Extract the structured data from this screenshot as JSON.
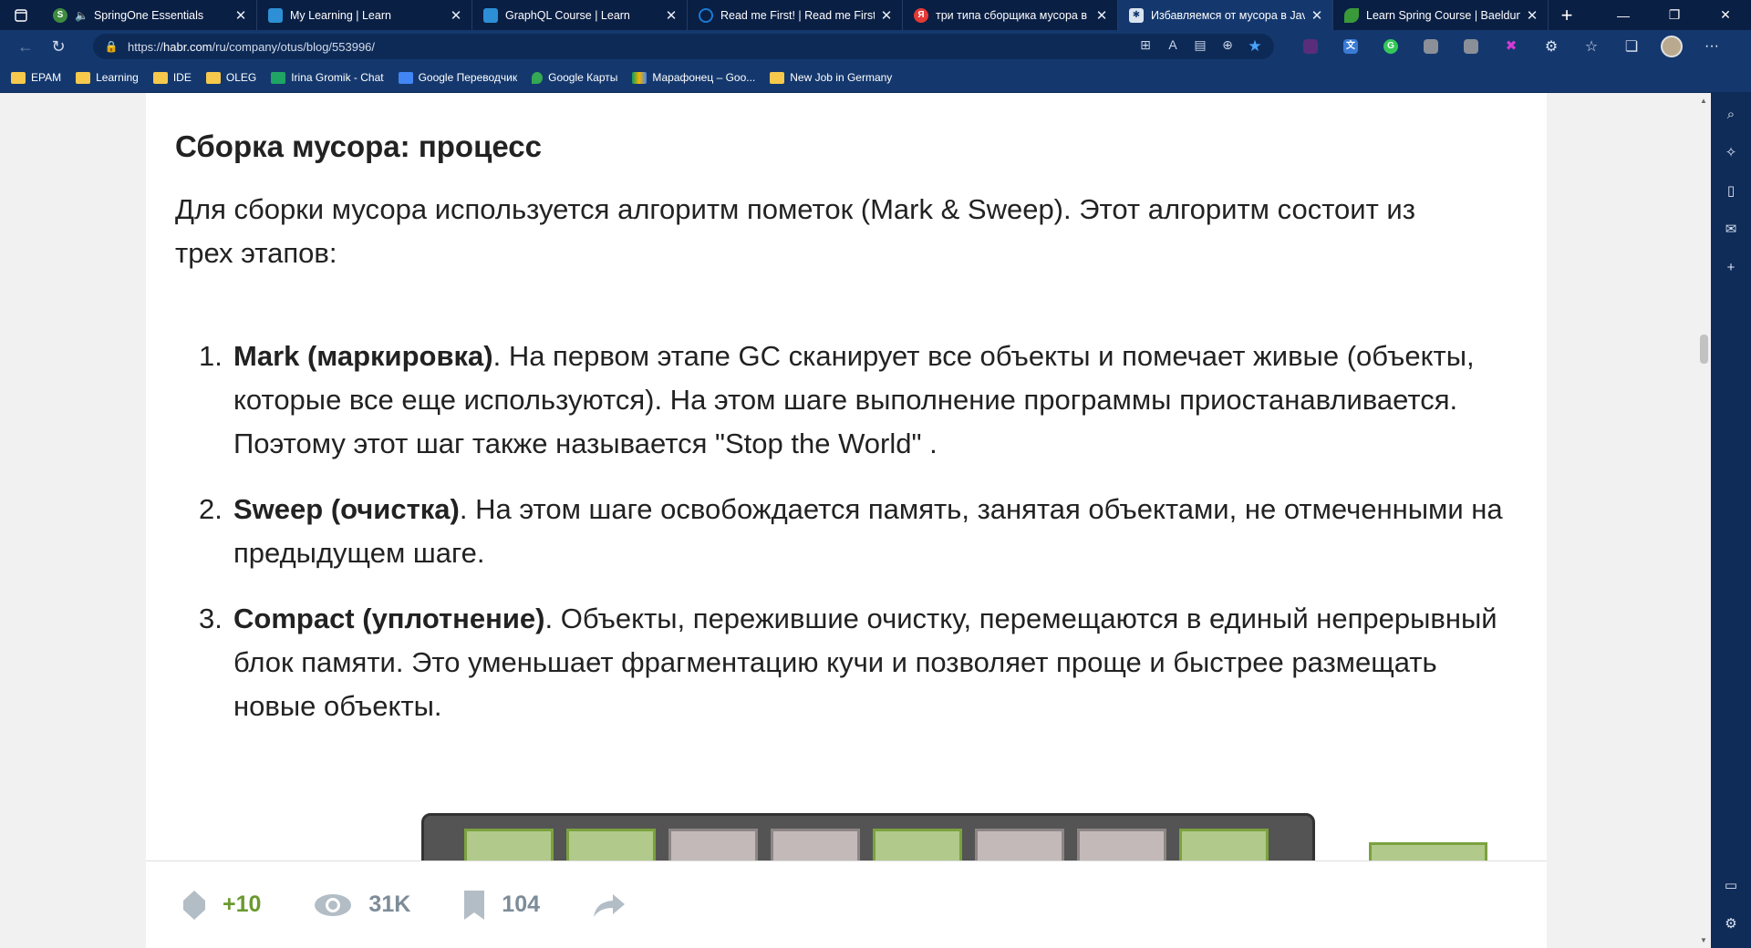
{
  "tabs": [
    {
      "title": "SpringOne Essentials",
      "favicon": "spring-s-icon",
      "color": "#3d8c40",
      "muted": true,
      "active": false
    },
    {
      "title": "My Learning | Learn",
      "favicon": "learn-book-icon",
      "color": "#2d8fd5",
      "active": false
    },
    {
      "title": "GraphQL Course | Learn",
      "favicon": "learn-book-icon",
      "color": "#2d8fd5",
      "active": false
    },
    {
      "title": "Read me First! | Read me First! | A",
      "favicon": "circle-o-icon",
      "color": "#1a7ad6",
      "active": false
    },
    {
      "title": "три типа сборщика мусора в л...",
      "favicon": "yandex-icon",
      "color": "#e53935",
      "active": false
    },
    {
      "title": "Избавляемся от мусора в Java",
      "favicon": "habr-icon",
      "color": "#d9e4f0",
      "active": true
    },
    {
      "title": "Learn Spring Course | Baeldung",
      "favicon": "baeldung-leaf-icon",
      "color": "#3a9a3a",
      "active": false
    }
  ],
  "address": {
    "prefix": "https://",
    "host": "habr.com",
    "path": "/ru/company/otus/blog/553996/"
  },
  "bookmarks": [
    {
      "label": "EPAM",
      "icon": "folder-icon"
    },
    {
      "label": "Learning",
      "icon": "folder-icon"
    },
    {
      "label": "IDE",
      "icon": "folder-icon"
    },
    {
      "label": "OLEG",
      "icon": "folder-icon"
    },
    {
      "label": "Irina Gromik - Chat",
      "icon": "chat-icon"
    },
    {
      "label": "Google Переводчик",
      "icon": "translate-icon"
    },
    {
      "label": "Google Карты",
      "icon": "maps-pin-icon"
    },
    {
      "label": "Марафонец – Goo...",
      "icon": "drive-icon"
    },
    {
      "label": "New Job in Germany",
      "icon": "folder-icon"
    }
  ],
  "article": {
    "heading": "Сборка мусора: процесс",
    "intro": "Для сборки мусора используется алгоритм пометок (Mark & Sweep). Этот алгоритм состоит из трех этапов:",
    "steps": [
      {
        "num": "1.",
        "bold": "Mark (маркировка)",
        "text": ". На первом этапе GC сканирует все объекты и помечает живые (объекты, которые все еще используются). На этом шаге выполнение программы приостанавливается. Поэтому этот шаг также называется \"Stop the World\" ."
      },
      {
        "num": "2.",
        "bold": "Sweep (очистка)",
        "text": ". На этом шаге освобождается память, занятая объектами, не отмеченными на предыдущем шаге."
      },
      {
        "num": "3.",
        "bold": "Compact (уплотнение)",
        "text": ". Объекты, пережившие очистку, перемещаются в единый непрерывный блок памяти. Это уменьшает фрагментацию кучи и позволяет проще и быстрее размещать новые объекты."
      }
    ]
  },
  "stats": {
    "rating": "+10",
    "views": "31K",
    "bookmarks": "104"
  },
  "colors": {
    "tab_bg": "#0a1f44",
    "toolbar_bg": "#14386e",
    "rating_green": "#6a9a2f",
    "stat_gray": "#7d8c99",
    "live_cell": "#b1c98a",
    "dead_cell": "#c4b9b9"
  }
}
